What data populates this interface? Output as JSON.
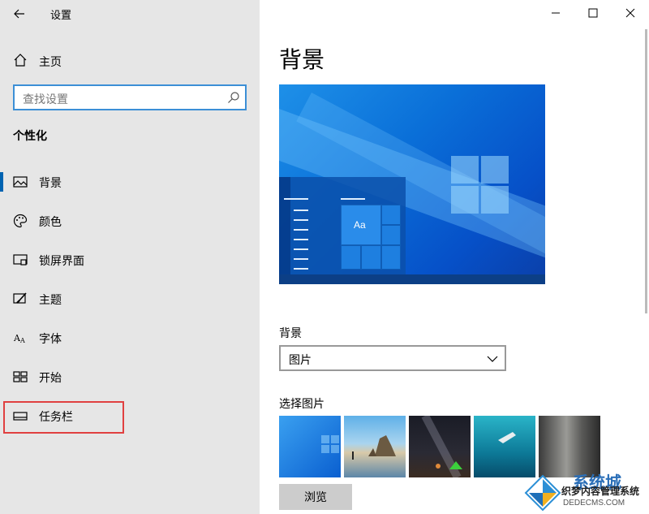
{
  "window": {
    "title": "设置",
    "controls": [
      "minimize",
      "maximize",
      "close"
    ]
  },
  "sidebar": {
    "home_label": "主页",
    "search_placeholder": "查找设置",
    "section_title": "个性化",
    "items": [
      {
        "label": "背景",
        "icon": "picture-icon",
        "active": true
      },
      {
        "label": "颜色",
        "icon": "palette-icon",
        "active": false
      },
      {
        "label": "锁屏界面",
        "icon": "lock-screen-icon",
        "active": false
      },
      {
        "label": "主题",
        "icon": "theme-brush-icon",
        "active": false
      },
      {
        "label": "字体",
        "icon": "font-icon",
        "active": false
      },
      {
        "label": "开始",
        "icon": "start-grid-icon",
        "active": false
      },
      {
        "label": "任务栏",
        "icon": "taskbar-icon",
        "active": false
      }
    ]
  },
  "main": {
    "page_title": "背景",
    "preview_sample_text": "Aa",
    "background_label": "背景",
    "background_value": "图片",
    "choose_label": "选择图片",
    "thumbnails": [
      "windows-blue",
      "beach-rocks",
      "night-sky-tent",
      "underwater-swimmer",
      "rock-cliff"
    ],
    "browse_label": "浏览"
  },
  "watermark": {
    "brand": "系统城",
    "line1": "织梦内容管理系统",
    "line2": "DEDECMS.COM"
  },
  "colors": {
    "sidebar_bg": "#e6e6e6",
    "accent": "#0063b1",
    "search_border": "#3c8fd6",
    "highlight": "#e04040"
  }
}
